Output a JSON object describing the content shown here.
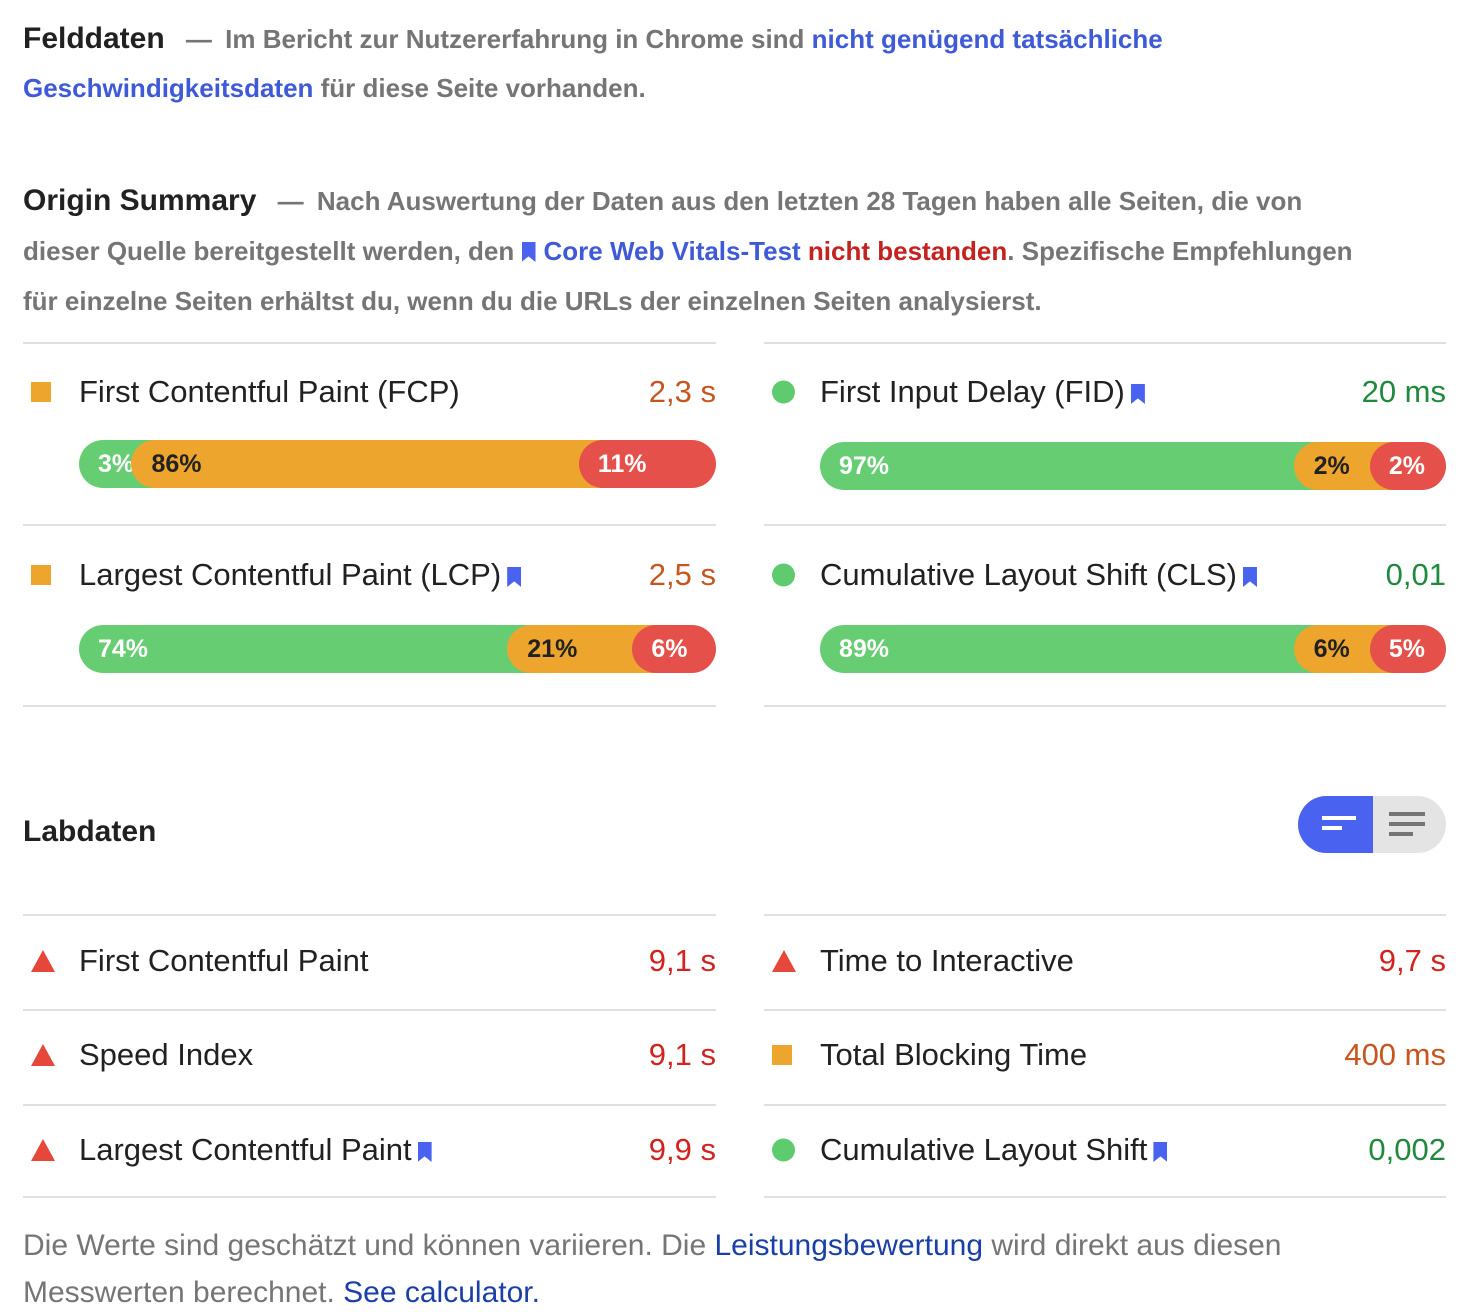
{
  "field": {
    "heading": "Felddaten",
    "dash": "—",
    "text_before": "Im Bericht zur Nutzererfahrung in Chrome sind ",
    "link": "nicht genügend tatsächliche Geschwindigkeitsdaten",
    "text_after": " für diese Seite vorhanden."
  },
  "origin": {
    "heading": "Origin Summary",
    "dash": "—",
    "text1": "Nach Auswertung der Daten aus den letzten 28 Tagen haben alle Seiten, die von dieser Quelle bereitgestellt werden, den ",
    "link": "Core Web Vitals-Test",
    "status": "nicht bestanden",
    "text2": ". Spezifische Empfehlungen für einzelne Seiten erhältst du, wenn du die URLs der einzelnen Seiten analysierst.",
    "metrics": [
      {
        "name": "First Contentful Paint (FCP)",
        "value": "2,3 s",
        "status_color": "#eea52e",
        "icon": "square-icon",
        "bookmark": false,
        "distribution": [
          {
            "label": "3%",
            "pct": 3
          },
          {
            "label": "86%",
            "pct": 86
          },
          {
            "label": "11%",
            "pct": 11
          }
        ]
      },
      {
        "name": "First Input Delay (FID)",
        "value": "20 ms",
        "status_color": "#5ecc6e",
        "icon": "circle-icon",
        "bookmark": true,
        "distribution": [
          {
            "label": "97%",
            "pct": 97
          },
          {
            "label": "2%",
            "pct": 2
          },
          {
            "label": "2%",
            "pct": 2
          }
        ]
      },
      {
        "name": "Largest Contentful Paint (LCP)",
        "value": "2,5 s",
        "status_color": "#eea52e",
        "icon": "square-icon",
        "bookmark": true,
        "distribution": [
          {
            "label": "74%",
            "pct": 74
          },
          {
            "label": "21%",
            "pct": 21
          },
          {
            "label": "6%",
            "pct": 6
          }
        ]
      },
      {
        "name": "Cumulative Layout Shift (CLS)",
        "value": "0,01",
        "status_color": "#5ecc6e",
        "icon": "circle-icon",
        "bookmark": true,
        "distribution": [
          {
            "label": "89%",
            "pct": 89
          },
          {
            "label": "6%",
            "pct": 6
          },
          {
            "label": "5%",
            "pct": 5
          }
        ]
      }
    ]
  },
  "lab": {
    "heading": "Labdaten",
    "toggle": {
      "active": "bar-view-icon",
      "inactive": "list-view-icon"
    },
    "metrics": [
      {
        "name": "First Contentful Paint",
        "value": "9,1 s",
        "icon": "triangle-icon",
        "bookmark": false
      },
      {
        "name": "Time to Interactive",
        "value": "9,7 s",
        "icon": "triangle-icon",
        "bookmark": false
      },
      {
        "name": "Speed Index",
        "value": "9,1 s",
        "icon": "triangle-icon",
        "bookmark": false
      },
      {
        "name": "Total Blocking Time",
        "value": "400 ms",
        "icon": "square-icon",
        "bookmark": false
      },
      {
        "name": "Largest Contentful Paint",
        "value": "9,9 s",
        "icon": "triangle-icon",
        "bookmark": true
      },
      {
        "name": "Cumulative Layout Shift",
        "value": "0,002",
        "icon": "circle-icon",
        "bookmark": true
      }
    ]
  },
  "footer": {
    "text1": "Die Werte sind geschätzt und können variieren. Die ",
    "link1": "Leistungsbewertung",
    "text2": " wird direkt aus diesen Messwerten berechnet. ",
    "link2": "See calculator."
  }
}
